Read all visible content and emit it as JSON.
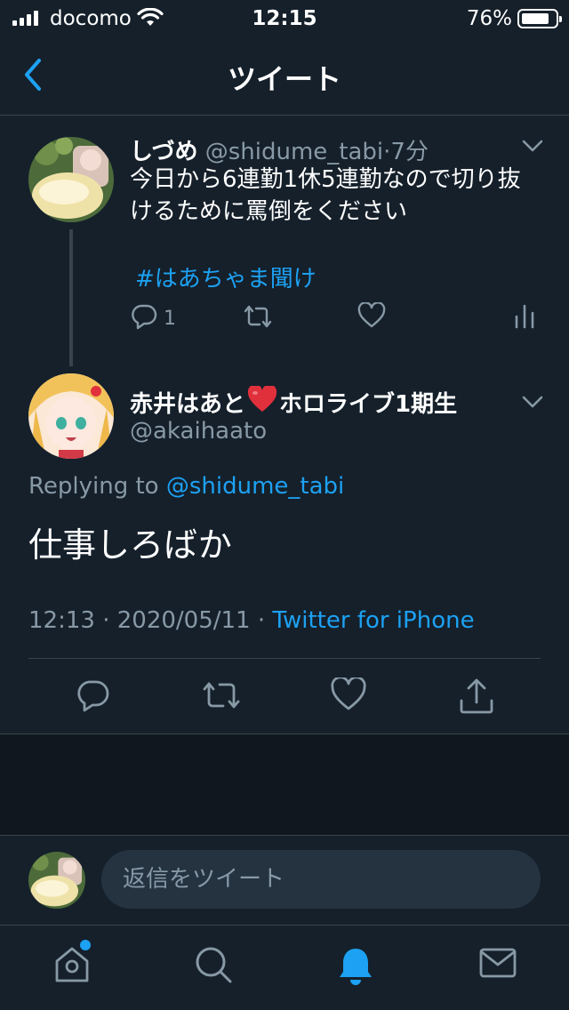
{
  "status_bar": {
    "carrier": "docomo",
    "time": "12:15",
    "battery": "76%",
    "battery_level": 0.76
  },
  "nav": {
    "title": "ツイート",
    "back_icon": "chevron-left-icon"
  },
  "parent_tweet": {
    "name": "しづめ",
    "handle": "@shidume_tabi",
    "separator": "·",
    "time_ago": "7分",
    "text": "今日から6連勤1休5連勤なので切り抜けるために罵倒をください",
    "hashtag": "#はあちゃま聞け",
    "reply_count": "1",
    "icons": [
      "reply-icon",
      "retweet-icon",
      "like-icon",
      "analytics-icon"
    ]
  },
  "main_tweet": {
    "name_part1": "赤井はあと",
    "name_emoji": "❤️",
    "name_part2": "ホロライブ1期生",
    "handle": "@akaihaato",
    "replying_prefix": "Replying to ",
    "replying_mention": "@shidume_tabi",
    "text": "仕事しろばか",
    "time": "12:13",
    "date": "2020/05/11",
    "separator": " · ",
    "source": "Twitter for iPhone",
    "icons": [
      "reply-icon",
      "retweet-icon",
      "like-icon",
      "share-icon"
    ]
  },
  "composer": {
    "placeholder": "返信をツイート"
  },
  "tab_bar": {
    "tabs": [
      "home-icon",
      "search-icon",
      "notifications-icon",
      "messages-icon"
    ],
    "active": "notifications-icon",
    "accent": "#1da1f2"
  },
  "colors": {
    "background": "#15202b",
    "secondary_text": "#8899a6",
    "accent": "#1da1f2",
    "divider": "#38444d"
  }
}
